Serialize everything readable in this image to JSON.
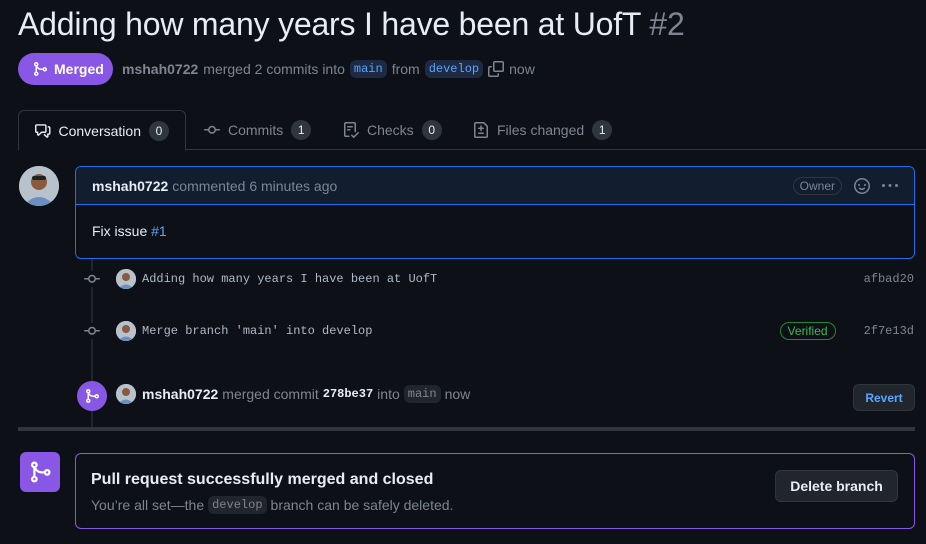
{
  "pr": {
    "title": "Adding how many years I have been at UofT",
    "number": "#2",
    "state_label": "Merged",
    "author": "mshah0722",
    "meta_merged": "merged 2 commits into",
    "base_branch": "main",
    "meta_from": "from",
    "head_branch": "develop",
    "meta_time": "now"
  },
  "tabs": [
    {
      "label": "Conversation",
      "count": "0"
    },
    {
      "label": "Commits",
      "count": "1"
    },
    {
      "label": "Checks",
      "count": "0"
    },
    {
      "label": "Files changed",
      "count": "1"
    }
  ],
  "comment": {
    "author": "mshah0722",
    "action": "commented 6 minutes ago",
    "role_badge": "Owner",
    "body_text": "Fix issue",
    "body_link": "#1"
  },
  "commits": [
    {
      "message": "Adding how many years I have been at UofT",
      "sha": "afbad20",
      "verified": ""
    },
    {
      "message": "Merge branch 'main' into develop",
      "sha": "2f7e13d",
      "verified": "Verified"
    }
  ],
  "merge_event": {
    "author": "mshah0722",
    "text_merged": "merged commit",
    "sha": "278be37",
    "text_into": "into",
    "branch": "main",
    "time": "now",
    "revert_label": "Revert"
  },
  "merged_box": {
    "title": "Pull request successfully merged and closed",
    "sub_before": "You’re all set—the",
    "branch": "develop",
    "sub_after": "branch can be safely deleted.",
    "delete_label": "Delete branch"
  },
  "colors": {
    "merged_purple": "#8957e5",
    "link_blue": "#58a6ff",
    "verified_green": "#3fb950",
    "background": "#0d1117"
  }
}
